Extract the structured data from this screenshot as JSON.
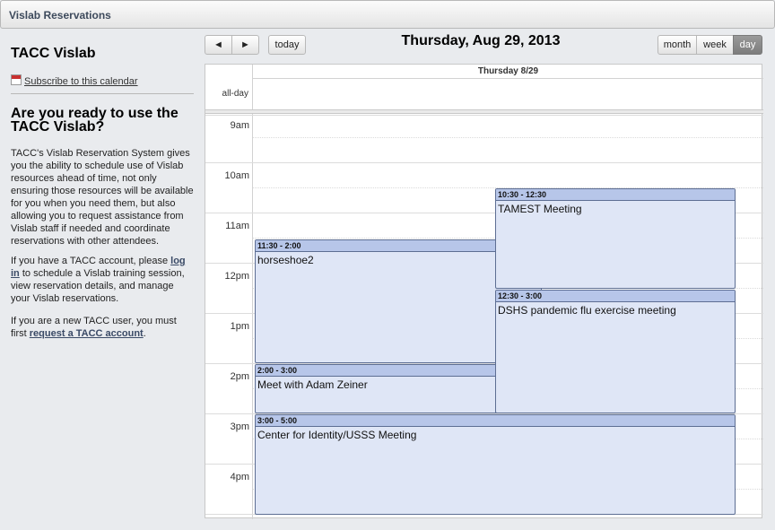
{
  "app": {
    "title": "Vislab Reservations"
  },
  "sidebar": {
    "title": "TACC Vislab",
    "subscribe_label": "Subscribe to this calendar",
    "heading": "Are you ready to use the TACC Vislab?",
    "para1": "TACC's Vislab Reservation System gives you the ability to schedule use of Vislab resources ahead of time, not only ensuring those resources will be available for you when you need them, but also allowing you to request assistance from Vislab staff if needed and coordinate reservations with other attendees.",
    "para2_pre": "If you have a TACC account, please ",
    "para2_link": "log in",
    "para2_post": " to schedule a Vislab training session, view reservation details, and manage your Vislab reservations.",
    "para3_pre": "If you are a new TACC user, you must first ",
    "para3_link": "request a TACC account",
    "para3_post": "."
  },
  "toolbar": {
    "prev_label": "◄",
    "next_label": "►",
    "today_label": "today",
    "date_title": "Thursday, Aug 29, 2013",
    "views": {
      "month": "month",
      "week": "week",
      "day": "day"
    },
    "active_view": "day"
  },
  "calendar": {
    "column_header": "Thursday 8/29",
    "allday_label": "all-day",
    "hours": [
      "9am",
      "10am",
      "11am",
      "12pm",
      "1pm",
      "2pm",
      "3pm",
      "4pm"
    ],
    "events": [
      {
        "time": "10:30 - 12:30",
        "title": "TAMEST Meeting"
      },
      {
        "time": "11:30 - 2:00",
        "title": "horseshoe2"
      },
      {
        "time": "12:30 - 3:00",
        "title": "DSHS pandemic flu exercise meeting"
      },
      {
        "time": "2:00 - 3:00",
        "title": "Meet with Adam Zeiner"
      },
      {
        "time": "3:00 - 5:00",
        "title": "Center for Identity/USSS Meeting"
      }
    ],
    "colors": {
      "event_header": "#b7c6e9",
      "event_body": "#dfe6f6",
      "event_border": "#5d6e93"
    }
  }
}
